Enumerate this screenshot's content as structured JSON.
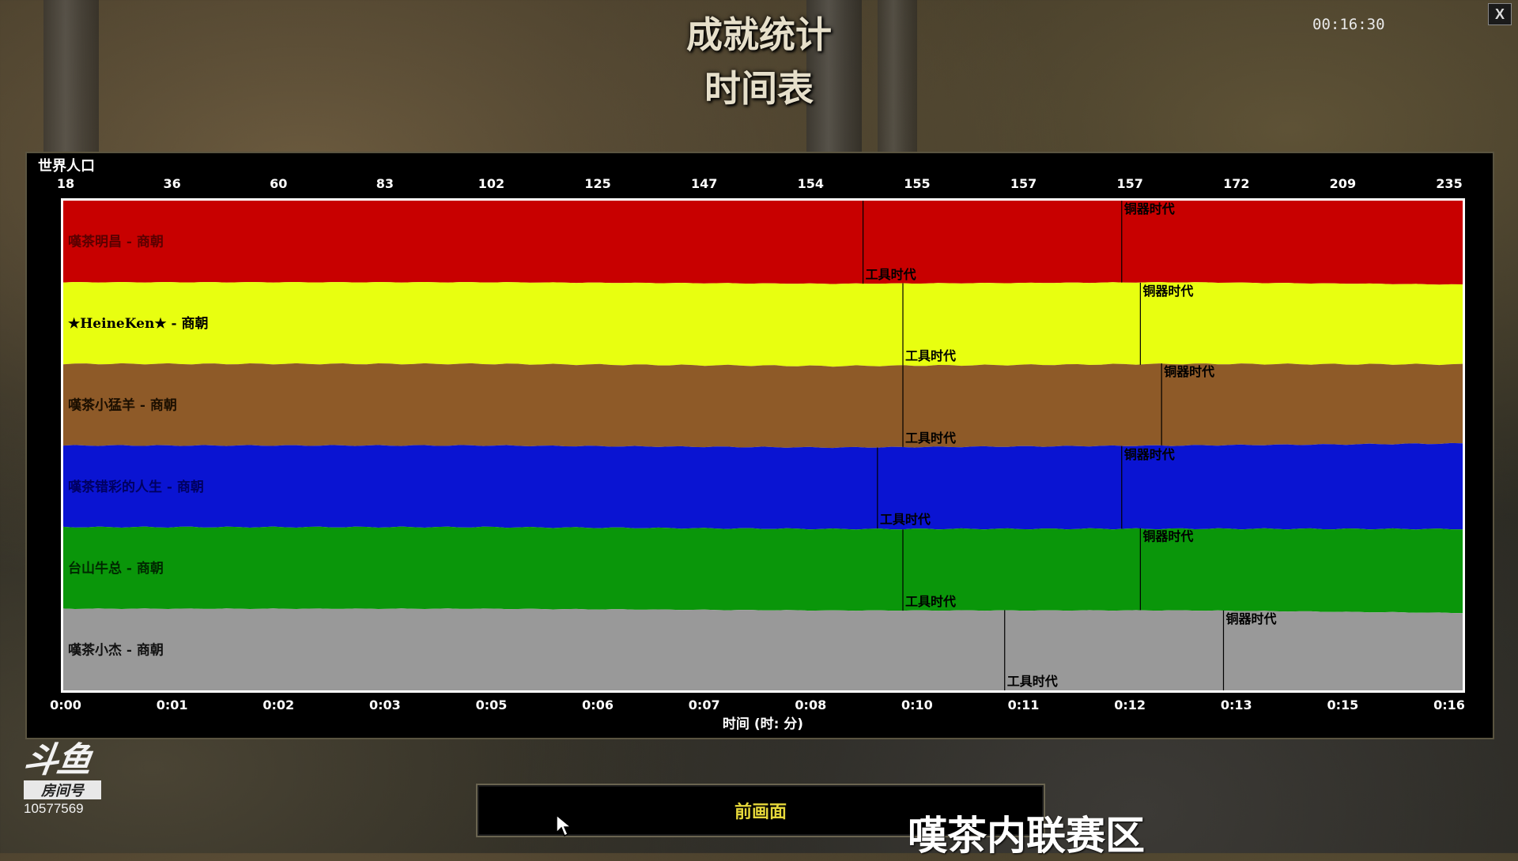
{
  "screen": {
    "title": "成就统计",
    "subtitle": "时间表",
    "clock": "00:16:30",
    "close_label": "X"
  },
  "panel": {
    "label": "世界人口"
  },
  "chart_data": {
    "type": "area",
    "top_axis_labels": [
      "18",
      "36",
      "60",
      "83",
      "102",
      "125",
      "147",
      "154",
      "155",
      "157",
      "157",
      "172",
      "209",
      "235"
    ],
    "x_tick_labels": [
      "0:00",
      "0:01",
      "0:02",
      "0:03",
      "0:05",
      "0:06",
      "0:07",
      "0:08",
      "0:10",
      "0:11",
      "0:12",
      "0:13",
      "0:15",
      "0:16"
    ],
    "xlabel": "时间 (时: 分)",
    "duration_minutes": 16.5,
    "series": [
      {
        "name": "嘆茶明昌 - 商朝",
        "color": "#c80000",
        "label_color": "#5a0000",
        "shares": [
          [
            0,
            1.0
          ],
          [
            0.3,
            1.0
          ],
          [
            0.55,
            1.02
          ],
          [
            0.8,
            1.0
          ],
          [
            1.0,
            1.03
          ]
        ],
        "events": [
          {
            "label": "工具时代",
            "t": 9.43
          },
          {
            "label": "铜器时代",
            "t": 12.48
          }
        ]
      },
      {
        "name": "★HeineKen★ - 商朝",
        "color": "#e8ff10",
        "label_color": "#000000",
        "shares": [
          [
            0,
            1.0
          ],
          [
            0.3,
            1.0
          ],
          [
            0.55,
            1.01
          ],
          [
            0.8,
            1.0
          ],
          [
            1.0,
            0.98
          ]
        ],
        "events": [
          {
            "label": "工具时代",
            "t": 9.9
          },
          {
            "label": "铜器时代",
            "t": 12.7
          }
        ]
      },
      {
        "name": "嘆茶小猛羊 - 商朝",
        "color": "#8e5a28",
        "label_color": "#1a0e00",
        "shares": [
          [
            0,
            1.0
          ],
          [
            0.3,
            1.0
          ],
          [
            0.55,
            1.0
          ],
          [
            0.8,
            1.0
          ],
          [
            1.0,
            0.97
          ]
        ],
        "events": [
          {
            "label": "工具时代",
            "t": 9.9
          },
          {
            "label": "铜器时代",
            "t": 12.95
          }
        ]
      },
      {
        "name": "嘆茶错彩的人生 - 商朝",
        "color": "#0a14d2",
        "label_color": "#000060",
        "shares": [
          [
            0,
            1.0
          ],
          [
            0.3,
            1.0
          ],
          [
            0.55,
            1.0
          ],
          [
            0.8,
            1.02
          ],
          [
            1.0,
            1.05
          ]
        ],
        "events": [
          {
            "label": "工具时代",
            "t": 9.6
          },
          {
            "label": "铜器时代",
            "t": 12.48
          }
        ]
      },
      {
        "name": "台山牛总 - 商朝",
        "color": "#0a960a",
        "label_color": "#002800",
        "shares": [
          [
            0,
            1.0
          ],
          [
            0.3,
            1.0
          ],
          [
            0.55,
            1.0
          ],
          [
            0.8,
            1.0
          ],
          [
            1.0,
            1.03
          ]
        ],
        "events": [
          {
            "label": "工具时代",
            "t": 9.9
          },
          {
            "label": "铜器时代",
            "t": 12.7
          }
        ]
      },
      {
        "name": "嘆茶小杰 - 商朝",
        "color": "#999999",
        "label_color": "#111111",
        "shares": [
          [
            0,
            1.0
          ],
          [
            0.3,
            1.0
          ],
          [
            0.55,
            0.98
          ],
          [
            0.8,
            0.98
          ],
          [
            1.0,
            0.95
          ]
        ],
        "events": [
          {
            "label": "工具时代",
            "t": 11.1
          },
          {
            "label": "铜器时代",
            "t": 13.68
          }
        ]
      }
    ]
  },
  "footer": {
    "back_label": "前画面",
    "caption": "嘆茶内联赛区"
  },
  "logo": {
    "main": "斗鱼",
    "tag": "房间号",
    "room_number": "10577569"
  }
}
